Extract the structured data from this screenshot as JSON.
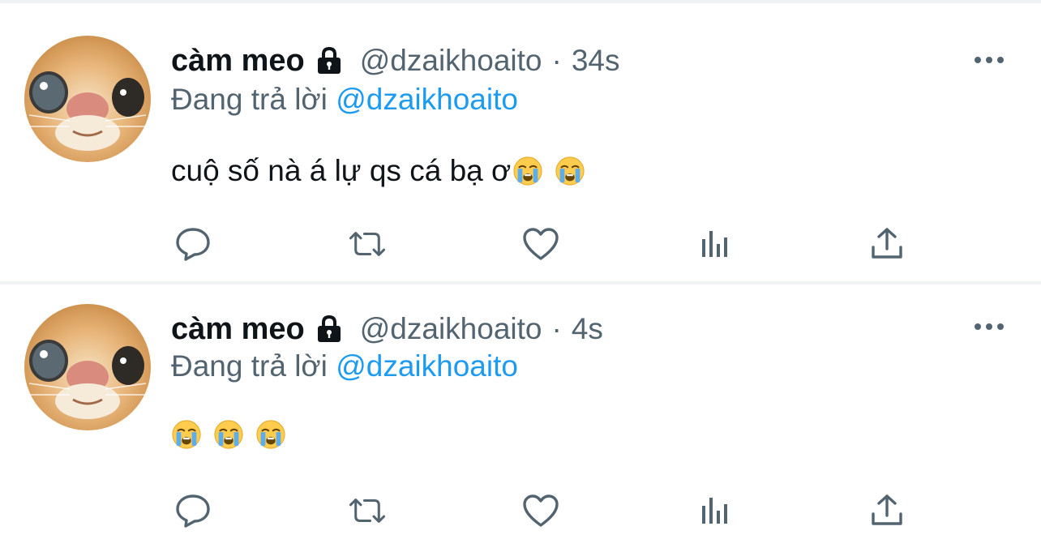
{
  "colors": {
    "text": "#0f1419",
    "muted": "#536471",
    "link": "#1d9bf0",
    "divider": "#eff3f4"
  },
  "tweets": [
    {
      "name": "càm meo",
      "handle": "@dzaikhoaito",
      "separator": "·",
      "time": "34s",
      "reply_prefix": "Đang trả lời",
      "reply_handle": "@dzaikhoaito",
      "text": "cuộ số nà á lự qs cá bạ ơ",
      "emojis": [
        "loudly-crying-face",
        "loudly-crying-face"
      ],
      "actions": [
        "reply-icon",
        "retweet-icon",
        "like-icon",
        "views-icon",
        "share-icon"
      ]
    },
    {
      "name": "càm meo",
      "handle": "@dzaikhoaito",
      "separator": "·",
      "time": "4s",
      "reply_prefix": "Đang trả lời",
      "reply_handle": "@dzaikhoaito",
      "text": "",
      "emojis": [
        "loudly-crying-face",
        "loudly-crying-face",
        "loudly-crying-face"
      ],
      "actions": [
        "reply-icon",
        "retweet-icon",
        "like-icon",
        "views-icon",
        "share-icon"
      ]
    }
  ]
}
